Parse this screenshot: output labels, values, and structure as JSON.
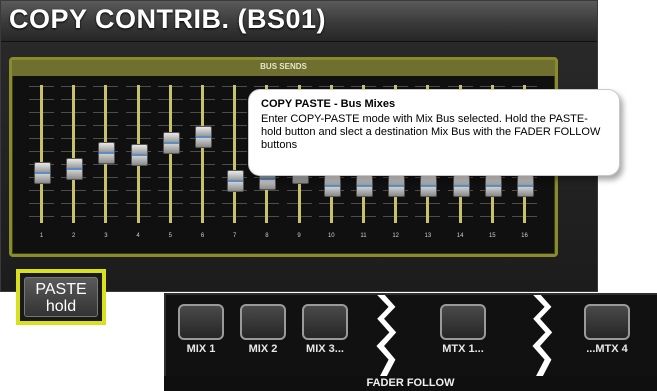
{
  "title": "COPY CONTRIB. (BS01)",
  "bus_sends": {
    "label": "BUS SENDS",
    "channels": [
      {
        "number": "1",
        "level": 0.35
      },
      {
        "number": "2",
        "level": 0.38
      },
      {
        "number": "3",
        "level": 0.52
      },
      {
        "number": "4",
        "level": 0.5
      },
      {
        "number": "5",
        "level": 0.6
      },
      {
        "number": "6",
        "level": 0.65
      },
      {
        "number": "7",
        "level": 0.28
      },
      {
        "number": "8",
        "level": 0.3
      },
      {
        "number": "9",
        "level": 0.35
      },
      {
        "number": "10",
        "level": 0.24
      },
      {
        "number": "11",
        "level": 0.24
      },
      {
        "number": "12",
        "level": 0.24
      },
      {
        "number": "13",
        "level": 0.24
      },
      {
        "number": "14",
        "level": 0.24
      },
      {
        "number": "15",
        "level": 0.24
      },
      {
        "number": "16",
        "level": 0.24
      }
    ]
  },
  "paste": {
    "line1": "PASTE",
    "line2": "hold"
  },
  "callout": {
    "title": "COPY PASTE - Bus Mixes",
    "body": "Enter COPY-PASTE mode with Mix Bus selected. Hold the PASTE-hold button and slect a destination Mix Bus with the FADER FOLLOW buttons"
  },
  "fader_follow": {
    "label": "FADER FOLLOW",
    "buttons": [
      {
        "label": "MIX 1"
      },
      {
        "label": "MIX 2"
      },
      {
        "label": "MIX 3..."
      },
      {
        "label": "MTX 1..."
      },
      {
        "label": "...MTX 4"
      }
    ]
  },
  "colors": {
    "accent_yellow": "#d8e020",
    "panel_olive": "#8a8b2c"
  }
}
